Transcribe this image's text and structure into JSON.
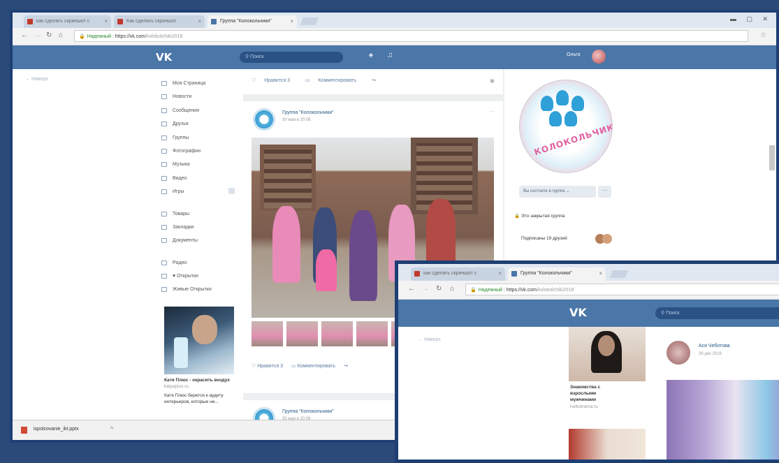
{
  "main_window": {
    "tabs": [
      {
        "label": "как сделать скриншот с",
        "active": false
      },
      {
        "label": "Как сделать скриншот",
        "active": false
      },
      {
        "label": "Группа \"Колокольчики\"",
        "active": true
      }
    ],
    "address": {
      "secure_label": "Надежный",
      "url_host": "https://vk.com",
      "url_path": "/kolokolchiki2018"
    },
    "header": {
      "logo": "VK",
      "search_placeholder": "Поиск",
      "user_name": "Ольга"
    },
    "back_label": "← Наверх",
    "menu": {
      "items": [
        "Моя Страница",
        "Новости",
        "Сообщения",
        "Друзья",
        "Группы",
        "Фотографии",
        "Музыка",
        "Видео",
        "Игры"
      ],
      "items2": [
        "Товары",
        "Закладки",
        "Документы"
      ],
      "items3": [
        "Радио",
        "♥ Открытки",
        "Живые Открытки"
      ]
    },
    "ad": {
      "title": "Катя Плюс - окрасить воздух",
      "domain": "katyaplus.ru",
      "text": "Катя Плюс берется к аудиту интерьеров, которые не..."
    },
    "posts": [
      {
        "like_label": "Нравится 3",
        "comment_label": "Комментировать"
      },
      {
        "group_name": "Группа \"Колокольчики\"",
        "date": "30 мая в 20:06",
        "like_label": "Нравится 3",
        "comment_label": "Комментировать"
      },
      {
        "group_name": "Группа \"Колокольчики\"",
        "date": "30 мая в 20:06"
      }
    ],
    "group": {
      "logo_text": "КОЛОКОЛЬЧИК",
      "join_label": "Вы состоите в группе ⌄",
      "more_label": "···",
      "closed_label": "Это закрытая группа",
      "friends_label": "Подписаны 19 друзей"
    },
    "download": {
      "filename": "ispolzovanie_ikt.pptx",
      "arrow": "^"
    }
  },
  "overlay_window": {
    "tabs": [
      {
        "label": "как сделать скриншот с",
        "active": false
      },
      {
        "label": "Группа \"Колокольчики\"",
        "active": true
      }
    ],
    "address": {
      "secure_label": "Надежный",
      "url_host": "https://vk.com",
      "url_path": "/kolokolchiki2018"
    },
    "header": {
      "logo": "VK",
      "search_placeholder": "Поиск"
    },
    "back_label": "← Наверх",
    "ad": {
      "line1": "Знакомства с",
      "line2": "взрослыми",
      "line3": "мужчинами",
      "domain": "hellodrama.ru"
    },
    "post": {
      "author": "Ася Чеботова",
      "date": "26 дек 2016"
    }
  },
  "colors": {
    "vk_blue": "#4a76a8",
    "frame_border": "#1e3f73",
    "page_bg": "#edeef0"
  }
}
